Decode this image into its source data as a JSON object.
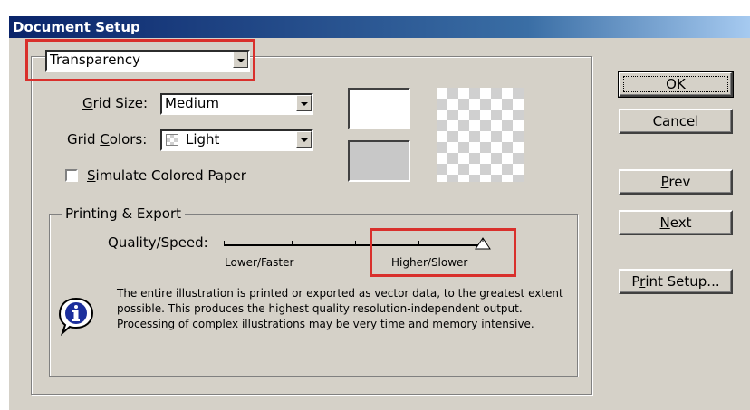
{
  "window": {
    "title": "Document Setup"
  },
  "panel_selector": {
    "value": "Transparency"
  },
  "grid_size": {
    "label": "Grid Size:",
    "label_u": "G",
    "label_rest": "rid Size:",
    "value": "Medium"
  },
  "grid_colors": {
    "label_u": "",
    "label_pre": "Grid ",
    "label_c": "C",
    "label_rest": "olors:",
    "value": "Light"
  },
  "simulate": {
    "label_u": "S",
    "label_rest": "imulate Colored Paper",
    "checked": false
  },
  "printing": {
    "legend": "Printing & Export",
    "quality_label": "Quality/Speed:",
    "lower": "Lower/Faster",
    "higher": "Higher/Slower",
    "info": "The entire illustration is printed or exported as vector data, to the greatest extent possible. This produces the highest quality resolution-independent output. Processing of complex illustrations may be very time and memory intensive."
  },
  "buttons": {
    "ok": "OK",
    "cancel": "Cancel",
    "prev_u": "P",
    "prev_rest": "rev",
    "next_u": "N",
    "next_rest": "ext",
    "print_pre": "P",
    "print_u": "r",
    "print_rest": "int Setup..."
  },
  "colors": {
    "highlight": "#d9302c",
    "face": "#d5d1c8",
    "title": "#0a246a"
  },
  "icons": [
    "info-icon",
    "dropdown-arrow-icon",
    "slider-thumb-icon",
    "grid-checker-icon"
  ]
}
